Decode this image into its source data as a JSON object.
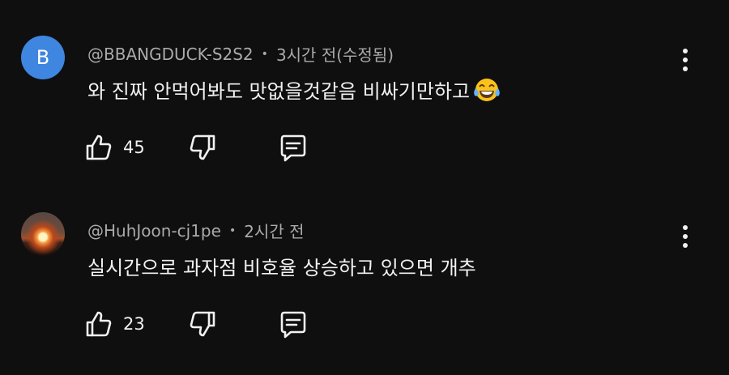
{
  "comments": [
    {
      "avatar_letter": "B",
      "avatar_color": "#3f86e0",
      "author": "@BBANGDUCK-S2S2",
      "separator": "•",
      "time": "3시간 전(수정됨)",
      "text": "와 진짜 안먹어봐도 맛없을것같음  비싸기만하고",
      "emoji_icon": "face-with-tears-of-joy-icon",
      "likes": "45"
    },
    {
      "avatar_image": "sunset-avatar",
      "author": "@HuhJoon-cj1pe",
      "separator": "•",
      "time": "2시간 전",
      "text": "실시간으로 과자점 비호율 상승하고 있으면 개추",
      "likes": "23"
    }
  ],
  "colors": {
    "background": "#0f0f0f",
    "primary_text": "#f1f1f1",
    "secondary_text": "#aaaaaa"
  }
}
